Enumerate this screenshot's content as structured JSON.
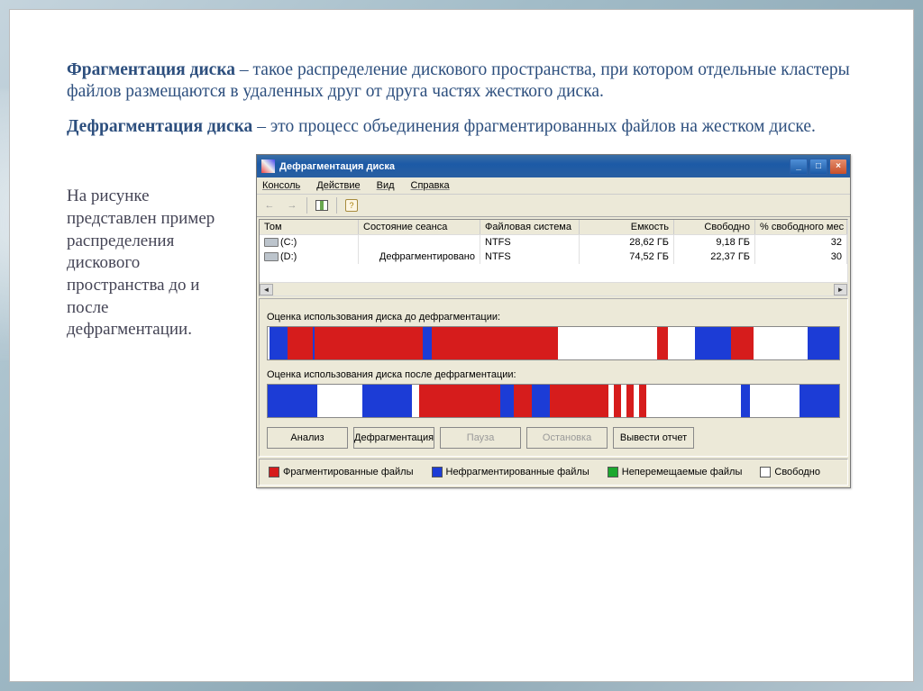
{
  "text": {
    "term1": "Фрагментация диска",
    "def1": " – такое распределение дискового пространства, при котором отдельные кластеры файлов размещаются в удаленных друг от друга частях жесткого диска.",
    "term2": "Дефрагментация диска",
    "def2": " – это процесс объединения фрагментированных файлов на жестком диске.",
    "caption": "На рисунке представлен пример распределения дискового пространства до и после дефрагментации."
  },
  "window": {
    "title": "Дефрагментация диска",
    "menu": [
      "Консоль",
      "Действие",
      "Вид",
      "Справка"
    ]
  },
  "table": {
    "headers": [
      "Том",
      "Состояние сеанса",
      "Файловая система",
      "Емкость",
      "Свободно",
      "% свободного мес"
    ],
    "rows": [
      {
        "vol": "(C:)",
        "state": "",
        "fs": "NTFS",
        "cap": "28,62 ГБ",
        "free": "9,18 ГБ",
        "pct": "32"
      },
      {
        "vol": "(D:)",
        "state": "Дефрагментировано",
        "fs": "NTFS",
        "cap": "74,52 ГБ",
        "free": "22,37 ГБ",
        "pct": "30"
      }
    ]
  },
  "frag": {
    "label_before": "Оценка использования диска до дефрагментации:",
    "label_after": "Оценка использования диска после дефрагментации:"
  },
  "buttons": {
    "analyze": "Анализ",
    "defrag": "Дефрагментация",
    "pause": "Пауза",
    "stop": "Остановка",
    "report": "Вывести отчет"
  },
  "legend": {
    "frag": "Фрагментированные файлы",
    "nofrag": "Нефрагментированные файлы",
    "fixed": "Неперемещаемые файлы",
    "free": "Свободно"
  },
  "colors": {
    "red": "#d61c1c",
    "blue": "#1c3cd6",
    "green": "#1ca82f",
    "white": "#ffffff"
  },
  "chart_data": [
    {
      "type": "bar",
      "title": "Оценка использования диска до дефрагментации",
      "series": [
        {
          "name": "segments",
          "colors": [
            "white",
            "blue",
            "red",
            "blue",
            "red",
            "blue",
            "red",
            "white",
            "red",
            "white",
            "blue",
            "red",
            "white",
            "blue"
          ],
          "widths": [
            2,
            20,
            28,
            2,
            120,
            10,
            140,
            110,
            12,
            30,
            40,
            25,
            60,
            45
          ]
        }
      ]
    },
    {
      "type": "bar",
      "title": "Оценка использования диска после дефрагментации",
      "series": [
        {
          "name": "segments",
          "colors": [
            "blue",
            "white",
            "blue",
            "white",
            "red",
            "blue",
            "red",
            "blue",
            "red",
            "white",
            "red",
            "white",
            "red",
            "white",
            "red",
            "white",
            "blue",
            "white",
            "blue"
          ],
          "widths": [
            55,
            50,
            55,
            8,
            90,
            15,
            20,
            20,
            65,
            6,
            8,
            6,
            8,
            6,
            8,
            105,
            10,
            55,
            50
          ]
        }
      ]
    }
  ]
}
